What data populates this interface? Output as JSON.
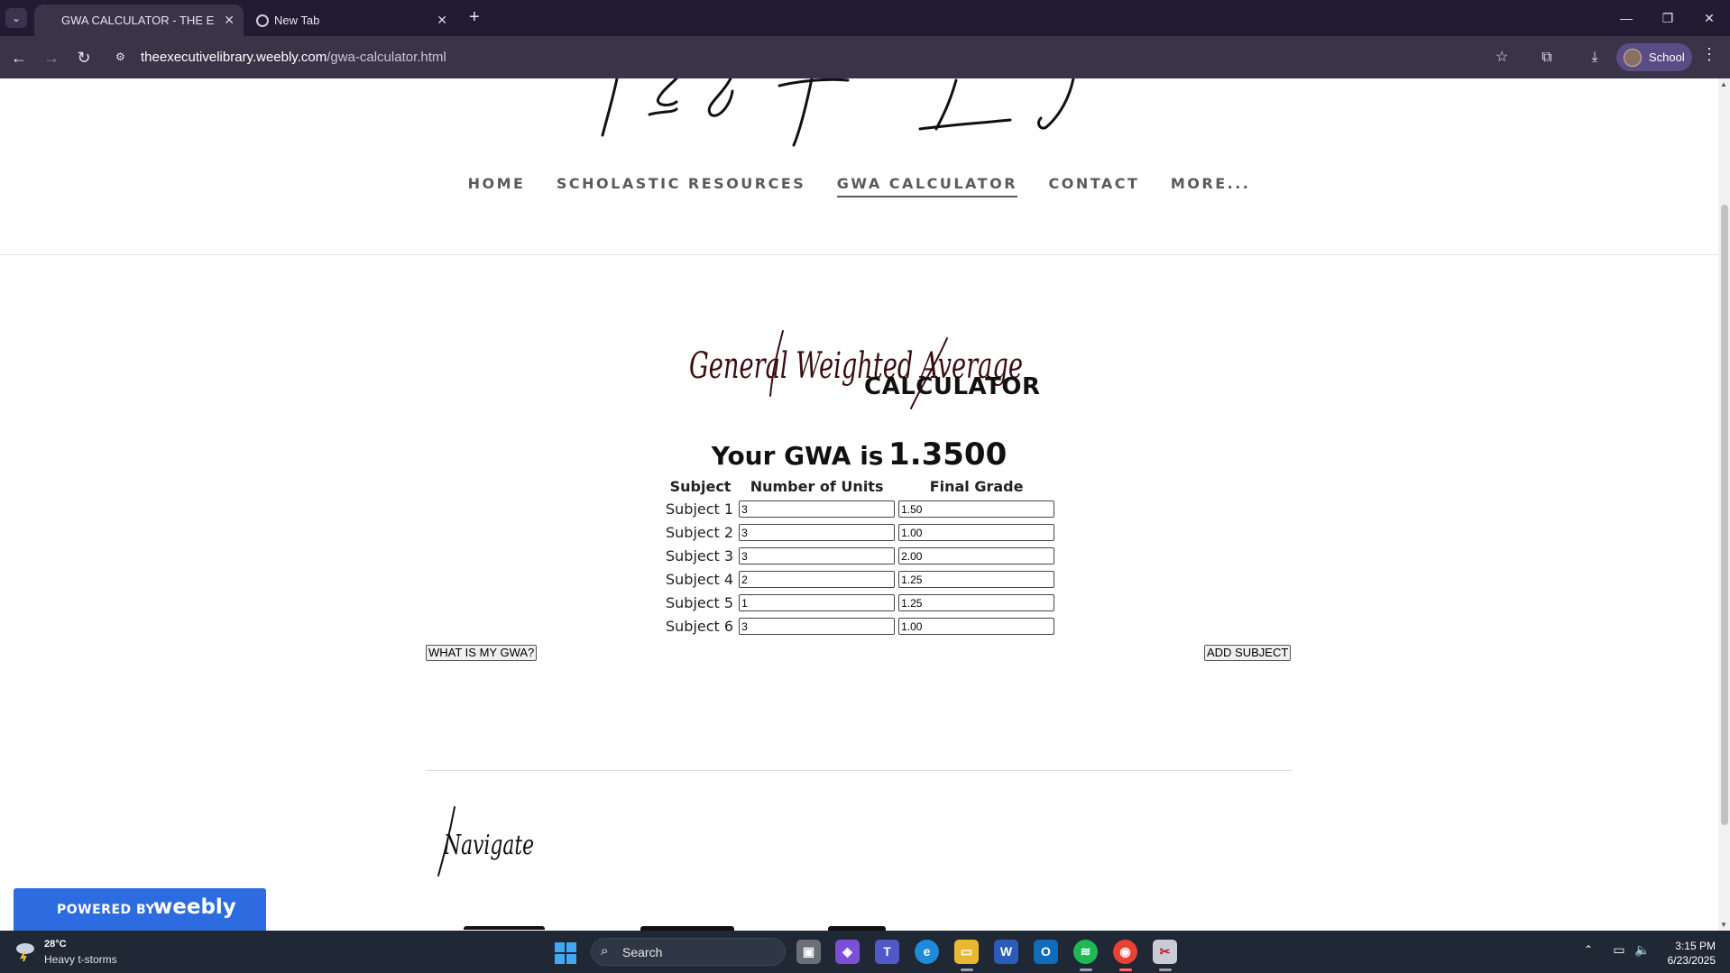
{
  "browser": {
    "tabs": [
      {
        "title": "GWA CALCULATOR - THE EXECU",
        "active": true
      },
      {
        "title": "New Tab",
        "active": false
      }
    ],
    "url_host": "theexecutivelibrary.weebly.com",
    "url_path": "/gwa-calculator.html",
    "profile_label": "School"
  },
  "site": {
    "nav": [
      "HOME",
      "SCHOLASTIC RESOURCES",
      "GWA CALCULATOR",
      "CONTACT",
      "MORE..."
    ],
    "active_nav": "GWA CALCULATOR",
    "calc_title_script": "General Weighted Average",
    "calc_subtitle": "CALCULATOR",
    "result_prefix": "Your GWA is",
    "result_value": "1.3500",
    "table": {
      "headers": [
        "Subject",
        "Number of Units",
        "Final Grade"
      ],
      "rows": [
        {
          "subject": "Subject 1",
          "units": "3",
          "grade": "1.50"
        },
        {
          "subject": "Subject 2",
          "units": "3",
          "grade": "1.00"
        },
        {
          "subject": "Subject 3",
          "units": "3",
          "grade": "2.00"
        },
        {
          "subject": "Subject 4",
          "units": "2",
          "grade": "1.25"
        },
        {
          "subject": "Subject 5",
          "units": "1",
          "grade": "1.25"
        },
        {
          "subject": "Subject 6",
          "units": "3",
          "grade": "1.00"
        }
      ]
    },
    "compute_button": "WHAT IS MY GWA?",
    "add_button": "ADD SUBJECT",
    "footer_heading_script": "Navigate",
    "badge_powered": "POWERED BY",
    "badge_brand": "weebly"
  },
  "taskbar": {
    "weather_temp": "28°C",
    "weather_desc": "Heavy t-storms",
    "search_placeholder": "Search",
    "time": "3:15 PM",
    "date": "6/23/2025"
  },
  "colors": {
    "chrome_dark": "#221c33",
    "chrome_toolbar": "#3a3449",
    "weebly_blue": "#2d6ce0",
    "taskbar": "#202735"
  }
}
